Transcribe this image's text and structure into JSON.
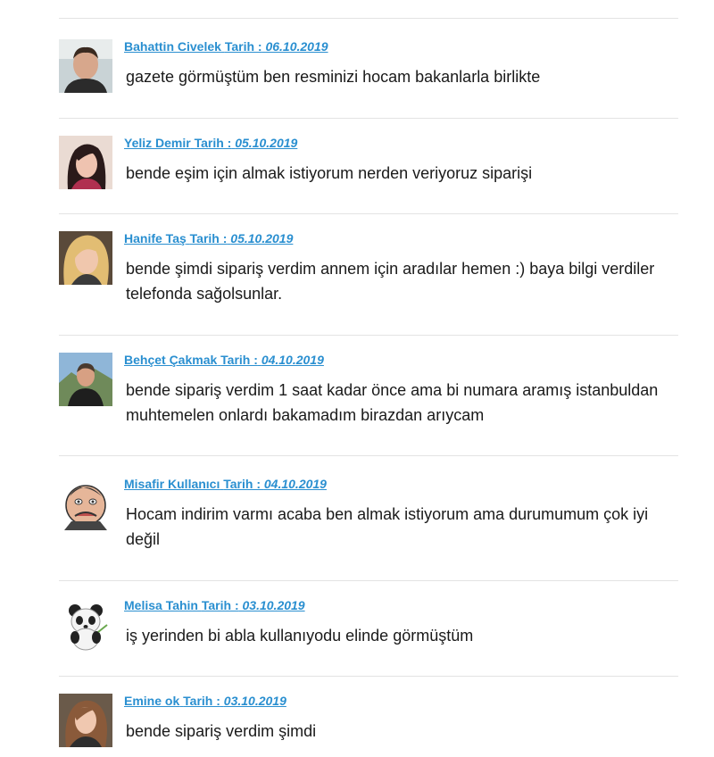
{
  "comments": [
    {
      "author": "Bahattin Civelek",
      "date_prefix": "Tarih :",
      "date": "06.10.2019",
      "text": "gazete görmüştüm ben resminizi hocam bakanlarla birlikte",
      "avatar_icon": "man-photo-avatar"
    },
    {
      "author": "Yeliz Demir",
      "date_prefix": "Tarih :",
      "date": "05.10.2019",
      "text": "bende eşim için almak istiyorum nerden veriyoruz siparişi",
      "avatar_icon": "woman-photo-avatar"
    },
    {
      "author": "Hanife Taş",
      "date_prefix": "Tarih :",
      "date": "05.10.2019",
      "text": "bende şimdi sipariş verdim annem için aradılar hemen :) baya bilgi verdiler telefonda sağolsunlar.",
      "avatar_icon": "blonde-woman-avatar"
    },
    {
      "author": "Behçet Çakmak",
      "date_prefix": "Tarih :",
      "date": "04.10.2019",
      "text": "bende sipariş verdim 1 saat kadar önce ama bi numara aramış istanbuldan muhtemelen onlardı bakamadım birazdan arıycam",
      "avatar_icon": "man-outdoor-avatar"
    },
    {
      "author": "Misafir Kullanıcı",
      "date_prefix": "Tarih :",
      "date": "04.10.2019",
      "text": "Hocam indirim varmı acaba ben almak istiyorum ama durumumum çok iyi değil",
      "avatar_icon": "cartoon-face-avatar"
    },
    {
      "author": "Melisa Tahin",
      "date_prefix": "Tarih :",
      "date": "03.10.2019",
      "text": "iş yerinden bi abla kullanıyodu elinde görmüştüm",
      "avatar_icon": "panda-avatar"
    },
    {
      "author": "Emine ok",
      "date_prefix": "Tarih :",
      "date": "03.10.2019",
      "text": "bende sipariş verdim şimdi",
      "avatar_icon": "woman-photo-avatar"
    }
  ]
}
